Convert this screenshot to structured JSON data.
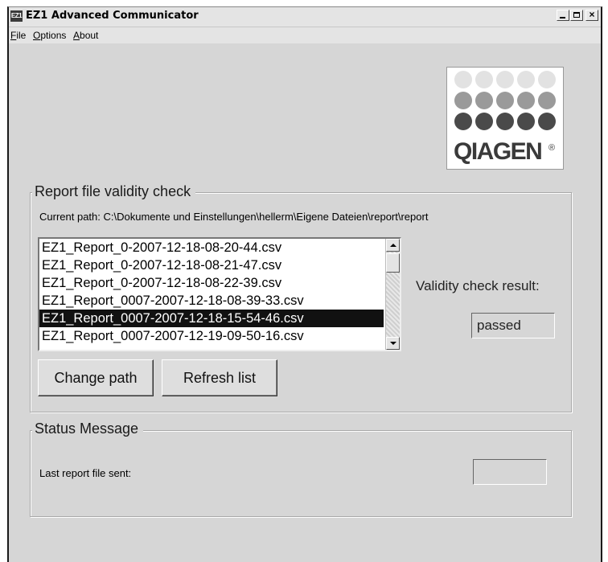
{
  "window": {
    "icon_text": "EZ1",
    "title": "EZ1 Advanced Communicator",
    "controls": {
      "minimize": "_",
      "maximize": "□",
      "close": "×"
    }
  },
  "menu": [
    {
      "label": "File",
      "underline": "F",
      "rest": "ile"
    },
    {
      "label": "Options",
      "underline": "O",
      "rest": "ptions"
    },
    {
      "label": "About",
      "underline": "A",
      "rest": "bout"
    }
  ],
  "logo": {
    "text": "QIAGEN",
    "registered": "®"
  },
  "validity": {
    "legend": "Report file validity check",
    "current_path": "Current path: C:\\Dokumente und Einstellungen\\hellerm\\Eigene Dateien\\report\\report",
    "files": [
      "EZ1_Report_0-2007-12-18-08-20-44.csv",
      "EZ1_Report_0-2007-12-18-08-21-47.csv",
      "EZ1_Report_0-2007-12-18-08-22-39.csv",
      "EZ1_Report_0007-2007-12-18-08-39-33.csv",
      "EZ1_Report_0007-2007-12-18-15-54-46.csv",
      "EZ1_Report_0007-2007-12-19-09-50-16.csv"
    ],
    "selected_index": 4,
    "change_path_label": "Change path",
    "refresh_list_label": "Refresh list",
    "result_label": "Validity check result:",
    "result_value": "passed"
  },
  "status": {
    "legend": "Status Message",
    "last_sent_label": "Last report file sent:",
    "last_sent_value": ""
  }
}
